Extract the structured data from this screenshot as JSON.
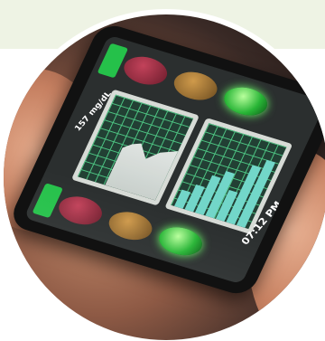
{
  "photo": {
    "readout": "157 mg/dL",
    "time": "07:12 PM",
    "light_colors": {
      "red": "#c2425a",
      "amber": "#cf9a4b",
      "green": "#28b536"
    }
  }
}
